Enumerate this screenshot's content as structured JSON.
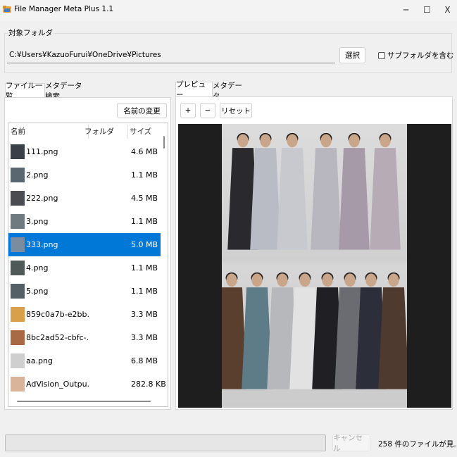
{
  "window": {
    "title": "File Manager Meta Plus 1.1",
    "minimize_glyph": "─",
    "maximize_glyph": "☐",
    "close_glyph": "X"
  },
  "folder_group": {
    "label": "対象フォルダ",
    "path": "C:¥Users¥KazuoFurui¥OneDrive¥Pictures",
    "select_label": "選択",
    "subfolders_label": "サブフォルダを含む",
    "subfolders_checked": false
  },
  "left_tabs": [
    "ファイル一覧",
    "メタデータ検索"
  ],
  "rename_label": "名前の変更",
  "file_list": {
    "columns": [
      "名前",
      "フォルダ",
      "サイズ"
    ],
    "rows": [
      {
        "name": "111.png",
        "size": "4.6 MB",
        "thumb": "#3a3f48"
      },
      {
        "name": "2.png",
        "size": "1.1 MB",
        "thumb": "#5a6770"
      },
      {
        "name": "222.png",
        "size": "4.5 MB",
        "thumb": "#4b4b52"
      },
      {
        "name": "3.png",
        "size": "1.1 MB",
        "thumb": "#6e7a7f"
      },
      {
        "name": "333.png",
        "size": "5.0 MB",
        "thumb": "#7a8ca0",
        "selected": true
      },
      {
        "name": "4.png",
        "size": "1.1 MB",
        "thumb": "#4f5a58"
      },
      {
        "name": "5.png",
        "size": "1.1 MB",
        "thumb": "#556066"
      },
      {
        "name": "859c0a7b-e2bb...",
        "size": "3.3 MB",
        "thumb": "#d8a04a"
      },
      {
        "name": "8bc2ad52-cbfc-...",
        "size": "3.3 MB",
        "thumb": "#a86a44"
      },
      {
        "name": "aa.png",
        "size": "6.8 MB",
        "thumb": "#cfcfcf"
      },
      {
        "name": "AdVision_Outpu...",
        "size": "282.8 KB",
        "thumb": "#d9b39a"
      }
    ]
  },
  "right_tabs": [
    "プレビュー",
    "メタデータ"
  ],
  "zoom": {
    "in_label": "+",
    "out_label": "−",
    "reset_label": "リセット"
  },
  "preview": {
    "top_row_colors": [
      "#2a2a2e",
      "#b9bcc4",
      "#c7c9cf",
      "#b8b6be",
      "#a79aa8",
      "#b7acb6"
    ],
    "bottom_row_colors": [
      "#5a3e2e",
      "#5e7b88",
      "#b6b8bc",
      "#e2e2e2",
      "#1f1f24",
      "#6b6b72",
      "#2c2e3a",
      "#4e3a2e"
    ]
  },
  "footer": {
    "cancel_label": "キャンセル",
    "status_text": "258 件のファイルが見..."
  },
  "colors": {
    "selection": "#0078d7",
    "preview_background": "#1e1e1e"
  }
}
